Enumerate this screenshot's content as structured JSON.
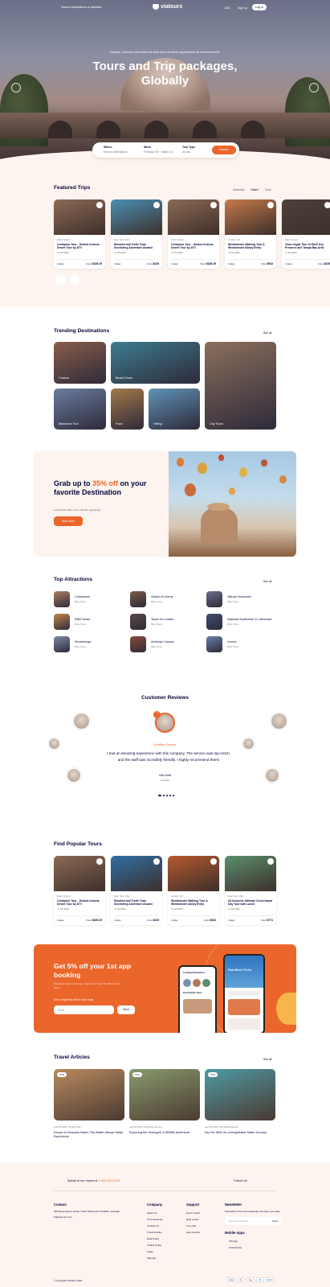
{
  "topbar": {
    "left_text": "Search destinations or activities",
    "brand": "viatours",
    "currency": "USD",
    "signup": "Sign up",
    "login": "Log in"
  },
  "hero": {
    "subtitle": "Explore, Discover and book the best tours & travel experiences all over the world.",
    "title_line1": "Tours and Trip packages,",
    "title_line2": "Globally"
  },
  "search": {
    "where_label": "Where",
    "where_value": "Search destinations",
    "when_label": "When",
    "when_value": "February 05 ~ March 14",
    "type_label": "Tour Type",
    "type_value": "All tour",
    "button": "Search"
  },
  "featured": {
    "title": "Featured Trips",
    "tabs": [
      "Adventure",
      "Nature",
      "Food"
    ],
    "cards": [
      {
        "loc": "Paris, France",
        "title": "Centipede Tour - Guided Arizona Desert Tour by ATV",
        "rating": "4.8 (243)",
        "days": "4 days",
        "price_from": "From",
        "price": "$189.25",
        "img": "#8c6a55"
      },
      {
        "loc": "New York, USA",
        "title": "Molokini and Turtle Town Snorkeling Adventure Aboard",
        "rating": "4.8 (243)",
        "days": "4 days",
        "price_from": "From",
        "price": "$225",
        "img": "#4a8fb5"
      },
      {
        "loc": "Paris, France",
        "title": "Centipede Tour - Guided Arizona Desert Tour by ATV",
        "rating": "4.8 (243)",
        "days": "4 days",
        "price_from": "From",
        "price": "$189.25",
        "img": "#8c6a55"
      },
      {
        "loc": "London, UK",
        "title": "Westminster Walking Tour & Westminster Abbey Entry",
        "rating": "4.8 (243)",
        "days": "4 days",
        "price_from": "From",
        "price": "$943",
        "img": "#c57a4c"
      },
      {
        "loc": "Paris, France",
        "title": "Clear Kayak Tour of Shell Key Preserve and Tampa Bay Area",
        "rating": "4.8 (243)",
        "days": "4 days",
        "price_from": "From",
        "price": "$225",
        "img": "#4e3f3a"
      }
    ]
  },
  "trending": {
    "title": "Trending Destinations",
    "see_all": "See all",
    "tiles": [
      {
        "name": "Cruises",
        "color": "#8a5e4a"
      },
      {
        "name": "Beach Tours",
        "color": "#3d7d8f"
      },
      {
        "name": "City Tours",
        "color": "#8b6f5c"
      },
      {
        "name": "Museums Tour",
        "color": "#6b7da0"
      },
      {
        "name": "Food",
        "color": "#a37a4a"
      },
      {
        "name": "Hiking",
        "color": "#5f93b7"
      }
    ]
  },
  "promo": {
    "title_pre": "Grab up to ",
    "title_highlight": "35% off",
    "title_post": " on your favorite Destination",
    "desc": "Limited time offer, don't miss the opportunity",
    "button": "Book Now"
  },
  "attractions": {
    "title": "Top Attractions",
    "see_all": "See all",
    "items": [
      {
        "name": "Colosseum",
        "tours": "500+ Tours",
        "color": "#a87e62"
      },
      {
        "name": "Statue of Liberty",
        "tours": "500+ Tours",
        "color": "#7a5a4a"
      },
      {
        "name": "Vatican Museums",
        "tours": "500+ Tours",
        "color": "#6b6f8a"
      },
      {
        "name": "Eiffel Tower",
        "tours": "500+ Tours",
        "color": "#c2874a"
      },
      {
        "name": "Tower of London",
        "tours": "500+ Tours",
        "color": "#5a4a45"
      },
      {
        "name": "National September 11 Memorial",
        "tours": "500+ Tours",
        "color": "#3f4f6e"
      },
      {
        "name": "Stonehenge",
        "tours": "500+ Tours",
        "color": "#7d8aa5"
      },
      {
        "name": "Antelope Canyon",
        "tours": "500+ Tours",
        "color": "#8b4a3a"
      },
      {
        "name": "Louvre",
        "tours": "500+ Tours",
        "color": "#6a7fa8"
      }
    ]
  },
  "reviews": {
    "title": "Customer Reviews",
    "label": "Excellent Service",
    "quote": "I had an amazing experience with this company. The service was top-notch, and the staff was incredibly friendly. I highly recommend them!",
    "author": "Jolie Smith",
    "role": "Canada"
  },
  "popular": {
    "title": "Find Popular Tours",
    "cards": [
      {
        "loc": "Paris, France",
        "title": "Centipede Tour - Guided Arizona Desert Tour by ATV",
        "rating": "4.8 (243)",
        "days": "4 days",
        "price_from": "From",
        "price": "$189.25",
        "img": "#8c6a55"
      },
      {
        "loc": "New York, USA",
        "title": "Molokini and Turtle Town Snorkeling Adventure Aboard",
        "rating": "4.8 (243)",
        "days": "4 days",
        "price_from": "From",
        "price": "$225",
        "img": "#2f6fa5"
      },
      {
        "loc": "London, UK",
        "title": "Westminster Walking Tour & Westminster Abbey Entry",
        "rating": "4.8 (243)",
        "days": "4 days",
        "price_from": "From",
        "price": "$943",
        "img": "#b5592f"
      },
      {
        "loc": "New York, USA",
        "title": "All Inclusive Ultimate Circle Island Day Tour with Lunch",
        "rating": "4.8 (243)",
        "days": "4 days",
        "price_from": "From",
        "price": "$771",
        "img": "#5a8f6e"
      }
    ]
  },
  "app": {
    "title": "Get 5% off your 1st app booking",
    "desc": "Booking's better on the app. Use promo code \"TourBooking\" to save!",
    "email_label": "Get a magic link sent to your email",
    "email_placeholder": "Email",
    "send": "Send",
    "phone_text1": "Trending Destinations",
    "phone_text2": "Find Popular Tours",
    "phone_title": "Find Where To Go"
  },
  "articles": {
    "title": "Travel Articles",
    "see_all": "See all",
    "items": [
      {
        "tag": "Trips",
        "meta": "April 06 2023  •  By Ali Tufan",
        "title": "Kenya vs Tanzania Safari: The Better African Safari Experience",
        "color": "#b98a5f"
      },
      {
        "tag": "Trips",
        "meta": "April 06 2023  •  By Emily Johnson",
        "title": "Exploring the Serengeti: A Wildlife Adventure",
        "color": "#8a9b6f"
      },
      {
        "tag": "Trips",
        "meta": "April 06 2023  •  By Michael Brown",
        "title": "Into the Wild: An Unforgettable Safari Journey",
        "color": "#4f9aa5"
      }
    ]
  },
  "footer": {
    "speak": "Speak to our expert at ",
    "phone": "1-800-453-6744",
    "follow": "Follow Us",
    "contact_title": "Contact",
    "address": "328 Queensberry Street, North Melbourne VIC3051, Australia.",
    "email": "hi@viatours.com",
    "company_title": "Company",
    "company_links": [
      "About Us",
      "Tours Reviews",
      "Contact Us",
      "Travel Guides",
      "Data Policy",
      "Cookie Policy",
      "Legal",
      "Sitemap"
    ],
    "support_title": "Support",
    "support_links": [
      "Get in Touch",
      "Help center",
      "Live chat",
      "How it works"
    ],
    "newsletter_title": "Newsletter",
    "newsletter_desc": "Subscribe to the free newsletter and stay up to date",
    "newsletter_placeholder": "Your email address",
    "newsletter_send": "Send",
    "mobile_title": "Mobile Apps",
    "mobile_links": [
      "iOS App",
      "Android App"
    ],
    "copyright": "© Copyright Viatours 2024",
    "payments": [
      "VISA",
      "MC",
      "Pay",
      "PP",
      "AMEX"
    ]
  },
  "colors": {
    "accent": "#eb662b",
    "navy": "#05073c",
    "cream": "#fdf4ef"
  }
}
